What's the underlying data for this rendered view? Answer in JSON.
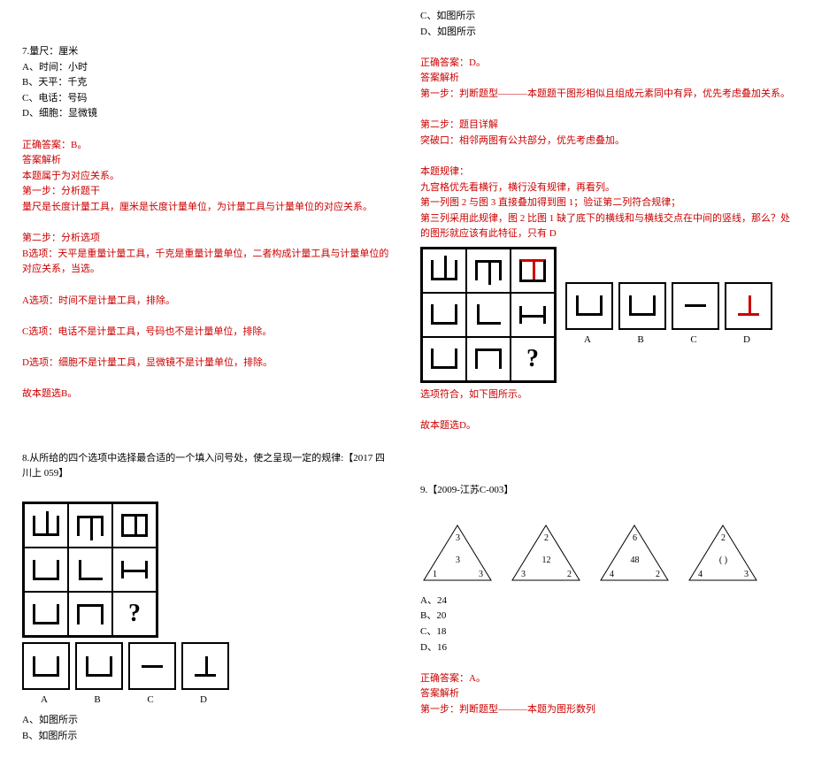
{
  "left": {
    "q7": {
      "stem": "7.量尺：厘米",
      "optA": "A、时间：小时",
      "optB": "B、天平：千克",
      "optC": "C、电话：号码",
      "optD": "D、细胞：显微镜",
      "ans_label": "正确答案：B。",
      "analysis_label": "答案解析",
      "line1": "本题属于为对应关系。",
      "step1_label": "第一步：分析题干",
      "step1_text": "量尺是长度计量工具，厘米是长度计量单位，为计量工具与计量单位的对应关系。",
      "step2_label": "第二步：分析选项",
      "optB_analysis": "B选项：天平是重量计量工具，千克是重量计量单位，二者构成计量工具与计量单位的对应关系，当选。",
      "optA_analysis": "A选项：时间不是计量工具，排除。",
      "optC_analysis": "C选项：电话不是计量工具，号码也不是计量单位，排除。",
      "optD_analysis": "D选项：细胞不是计量工具，显微镜不是计量单位，排除。",
      "conclusion": "故本题选B。"
    },
    "q8": {
      "stem": "8.从所给的四个选项中选择最合适的一个填入问号处，使之呈现一定的规律:【2017 四川上 059】",
      "qmark": "?",
      "labels": {
        "A": "A",
        "B": "B",
        "C": "C",
        "D": "D"
      },
      "optA": "A、如图所示",
      "optB": "B、如图所示"
    }
  },
  "right": {
    "q8_cont": {
      "optC": "C、如图所示",
      "optD": "D、如图所示",
      "ans_label": "正确答案：D。",
      "analysis_label": "答案解析",
      "step1": "第一步：判断题型———本题题干图形相似且组成元素同中有异，优先考虑叠加关系。",
      "step2_label": "第二步：题目详解",
      "step2_text": "突破口：相邻两图有公共部分，优先考虑叠加。",
      "rule_label": "本题规律：",
      "rule1": "九宫格优先看横行，横行没有规律，再看列。",
      "rule2": "第一列图 2 与图 3 直接叠加得到图 1；验证第二列符合规律；",
      "rule3": "第三列采用此规律，图 2 比图 1 缺了底下的横线和与横线交点在中间的竖线，那么？处的图形就应该有此特征，只有 D",
      "qmark": "?",
      "labels": {
        "A": "A",
        "B": "B",
        "C": "C",
        "D": "D"
      },
      "fit_text": "选项符合，如下图所示。",
      "conclusion": "故本题选D。"
    },
    "q9": {
      "stem": "9.【2009-江苏C-003】",
      "tri": [
        {
          "top": "3",
          "center": "3",
          "bl": "1",
          "br": "3"
        },
        {
          "top": "2",
          "center": "12",
          "bl": "3",
          "br": "2"
        },
        {
          "top": "6",
          "center": "48",
          "bl": "4",
          "br": "2"
        },
        {
          "top": "2",
          "center": "( )",
          "bl": "4",
          "br": "3"
        }
      ],
      "optA": "A、24",
      "optB": "B、20",
      "optC": "C、18",
      "optD": "D、16",
      "ans_label": "正确答案：A。",
      "analysis_label": "答案解析",
      "step1": "第一步：判断题型———本题为图形数列"
    }
  }
}
